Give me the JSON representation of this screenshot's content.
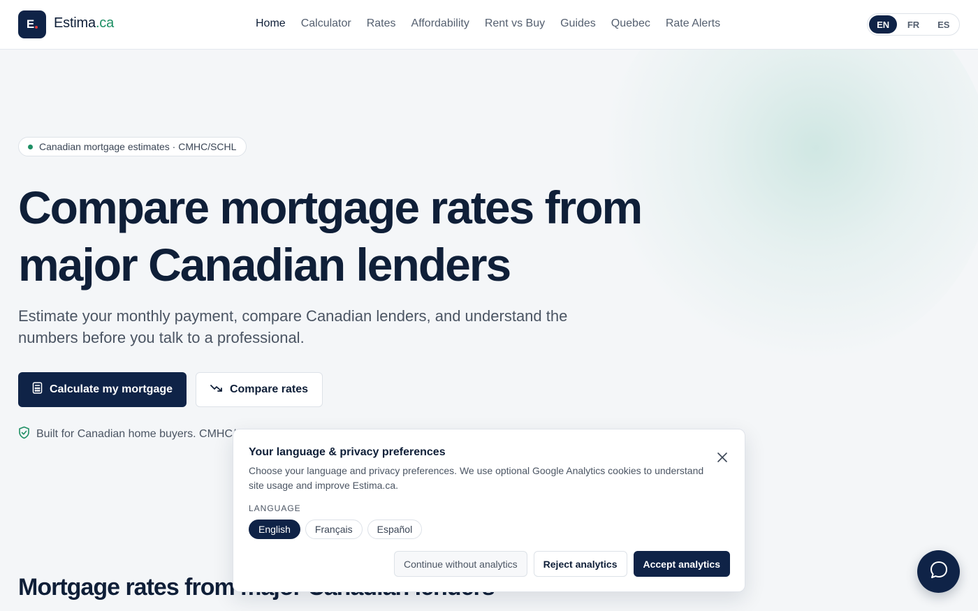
{
  "header": {
    "logo_letter": "E",
    "brand_name": "Estima",
    "brand_tld": ".ca",
    "nav": [
      {
        "label": "Home",
        "active": true
      },
      {
        "label": "Calculator"
      },
      {
        "label": "Rates"
      },
      {
        "label": "Affordability"
      },
      {
        "label": "Rent vs Buy"
      },
      {
        "label": "Guides"
      },
      {
        "label": "Quebec"
      },
      {
        "label": "Rate Alerts"
      }
    ],
    "language_switch": [
      {
        "label": "EN",
        "selected": true
      },
      {
        "label": "FR"
      },
      {
        "label": "ES"
      }
    ]
  },
  "hero": {
    "pill": "Canadian mortgage estimates · CMHC/SCHL",
    "title_line1": "Compare mortgage rates from",
    "title_line2": "major Canadian lenders",
    "subtitle": "Estimate your monthly payment, compare Canadian lenders, and understand the numbers before you talk to a professional.",
    "cta_primary": "Calculate my mortgage",
    "cta_secondary": "Compare rates",
    "trust_text": "Built for Canadian home buyers. CMHC/S"
  },
  "rates_section": {
    "title": "Mortgage rates from major Canadian lenders"
  },
  "consent_modal": {
    "title": "Your language & privacy preferences",
    "text": "Choose your language and privacy preferences. We use optional Google Analytics cookies to understand site usage and improve Estima.ca.",
    "language_label": "LANGUAGE",
    "languages": [
      {
        "label": "English",
        "selected": true
      },
      {
        "label": "Français"
      },
      {
        "label": "Español"
      }
    ],
    "continue_label": "Continue without analytics",
    "reject_label": "Reject analytics",
    "accept_label": "Accept analytics"
  },
  "icons": {
    "calculator": "calculator-icon",
    "trend": "trending-down-icon",
    "shield": "shield-check-icon",
    "close": "close-icon",
    "chat": "chat-bubble-icon"
  },
  "colors": {
    "primary": "#0f2347",
    "accent_green": "#1e8f64",
    "background": "#f4f6f8"
  }
}
